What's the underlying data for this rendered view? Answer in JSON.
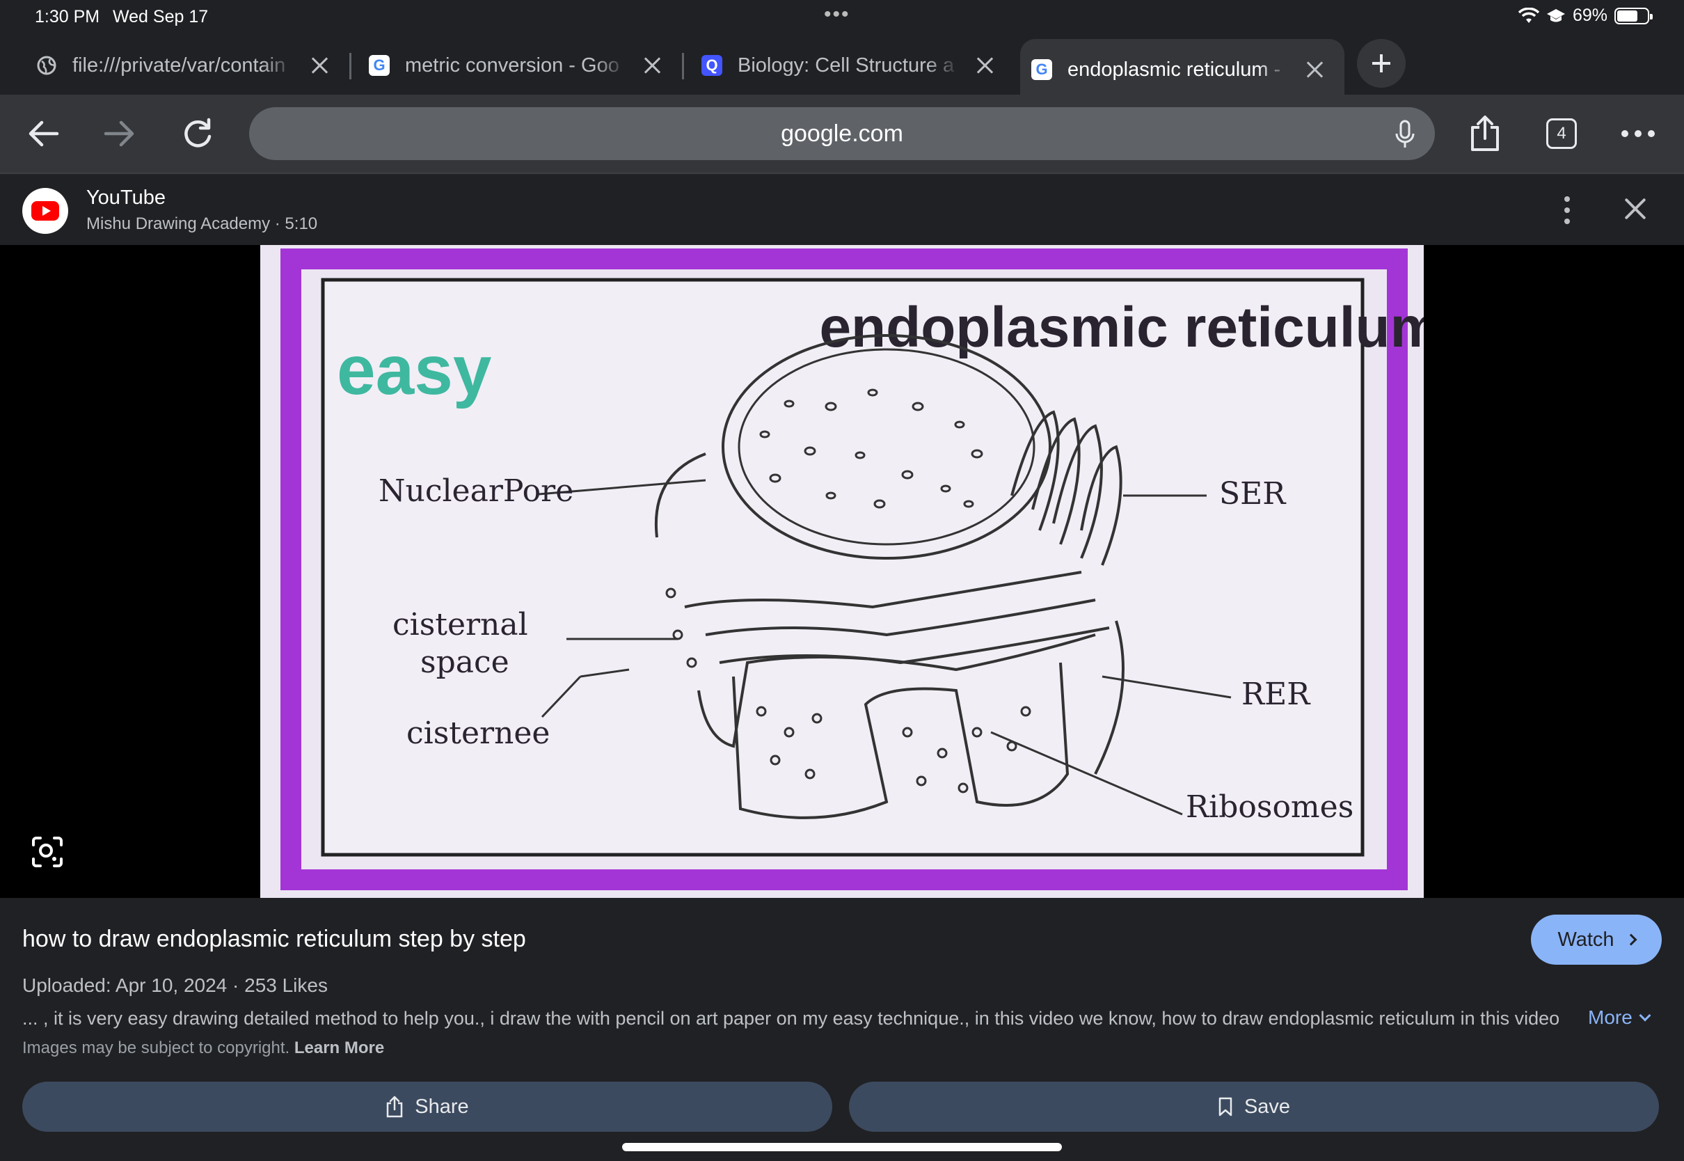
{
  "status_bar": {
    "time": "1:30 PM",
    "date": "Wed Sep 17",
    "battery": "69%",
    "battery_level": 0.69,
    "icons": [
      "wifi-icon",
      "education-icon",
      "battery-icon"
    ]
  },
  "tabs": [
    {
      "title": "file:///private/var/contain",
      "favicon": "globe-icon",
      "active": false
    },
    {
      "title": "metric conversion - Goo",
      "favicon": "google-icon",
      "active": false
    },
    {
      "title": "Biology: Cell Structure a",
      "favicon": "quizlet-icon",
      "active": false
    },
    {
      "title": "endoplasmic reticulum -",
      "favicon": "google-icon",
      "active": true
    }
  ],
  "toolbar": {
    "url": "google.com",
    "tab_count": "4"
  },
  "result": {
    "source": "YouTube",
    "meta": "Mishu Drawing Academy · 5:10",
    "title": "how to draw endoplasmic reticulum step by step",
    "uploaded": "Uploaded: Apr 10, 2024 · 253 Likes",
    "snippet": "... , it is very easy drawing detailed method to help you., i draw the with pencil on art paper on my easy technique., in this video we know, how to draw endoplasmic reticulum in this video",
    "more_label": "More",
    "watch_label": "Watch",
    "copyright_text": "Images may be subject to copyright.",
    "learn_more": "Learn More",
    "share_label": "Share",
    "save_label": "Save"
  },
  "preview": {
    "heading": "endoplasmic reticulum",
    "easy": "easy",
    "labels": {
      "nuclear_pore": "NuclearPore",
      "cisternal": "cisternal",
      "space": "space",
      "cisternee": "cisternee",
      "ser": "SER",
      "rer": "RER",
      "ribosomes": "Ribosomes"
    },
    "colors": {
      "border": "#a335d6",
      "easy": "#3fb8a0",
      "paper": "#ece6f2"
    }
  }
}
